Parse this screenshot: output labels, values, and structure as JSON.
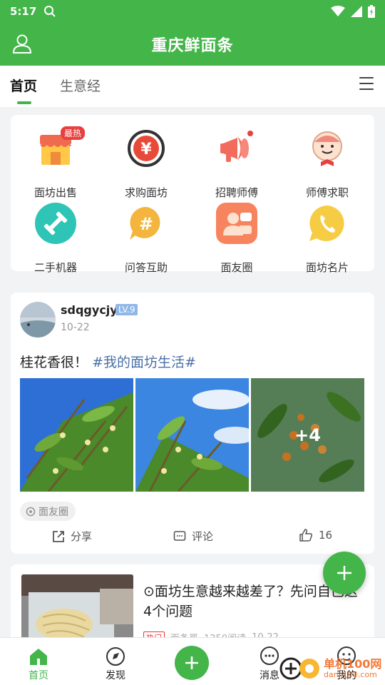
{
  "status_bar": {
    "time": "5:17"
  },
  "app_bar": {
    "title": "重庆鲜面条"
  },
  "tabs": [
    {
      "label": "首页",
      "active": true
    },
    {
      "label": "生意经",
      "active": false
    }
  ],
  "categories": [
    {
      "label": "面坊出售",
      "icon": "shop-icon",
      "badge": "最热"
    },
    {
      "label": "求购面坊",
      "icon": "yuan-icon"
    },
    {
      "label": "招聘师傅",
      "icon": "megaphone-icon"
    },
    {
      "label": "师傅求职",
      "icon": "chef-icon"
    },
    {
      "label": "二手机器",
      "icon": "dumbbell-icon"
    },
    {
      "label": "问答互助",
      "icon": "hashtag-icon"
    },
    {
      "label": "面友圈",
      "icon": "community-icon"
    },
    {
      "label": "面坊名片",
      "icon": "phone-icon"
    }
  ],
  "post": {
    "username": "sdqgycjy",
    "level": "LV.9",
    "date": "10-22",
    "text": "桂花香很！",
    "hashtag": "#我的面坊生活#",
    "more_photos": "+4",
    "topic": "面友圈",
    "share_label": "分享",
    "comment_label": "评论",
    "like_count": "16"
  },
  "article": {
    "title": "⊙面坊生意越来越差了？先问自己这4个问题",
    "badge": "热门",
    "author": "面条哥",
    "views": "1250阅读",
    "date": "10-22"
  },
  "bottom_nav": [
    {
      "label": "首页",
      "icon": "home-icon",
      "active": true
    },
    {
      "label": "发现",
      "icon": "discover-icon",
      "active": false
    },
    {
      "label": "消息",
      "icon": "message-icon",
      "active": false
    },
    {
      "label": "我的",
      "icon": "profile-icon",
      "active": false
    }
  ],
  "watermark": {
    "text": "单机100网",
    "sub": "danji100.com"
  },
  "colors": {
    "brand_green": "#43b549",
    "tag_blue": "#4a6fa5",
    "level_blue": "#8fb7e8"
  }
}
